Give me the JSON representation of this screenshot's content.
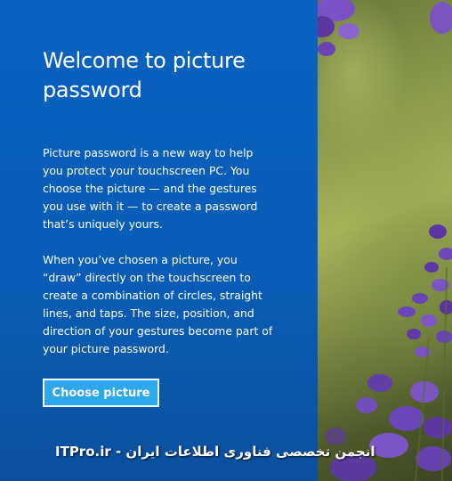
{
  "welcome": {
    "title": "Welcome to picture password",
    "paragraph1": "Picture password is a new way to help you protect your touchscreen PC. You choose the picture — and the gestures you use with it — to create a password that’s uniquely yours.",
    "paragraph2": "When you’ve chosen a picture, you “draw” directly on the touchscreen to create a combination of circles, straight lines, and taps. The size, position, and direction of your gestures become part of your picture password.",
    "choose_button_label": "Choose picture"
  },
  "watermark": {
    "text": "ITPro.ir - انجمن تخصصی فناوری اطلاعات ایران"
  },
  "colors": {
    "panel_background": "#0b62c0",
    "button_background": "#2da8ee",
    "text": "#ffffff"
  }
}
